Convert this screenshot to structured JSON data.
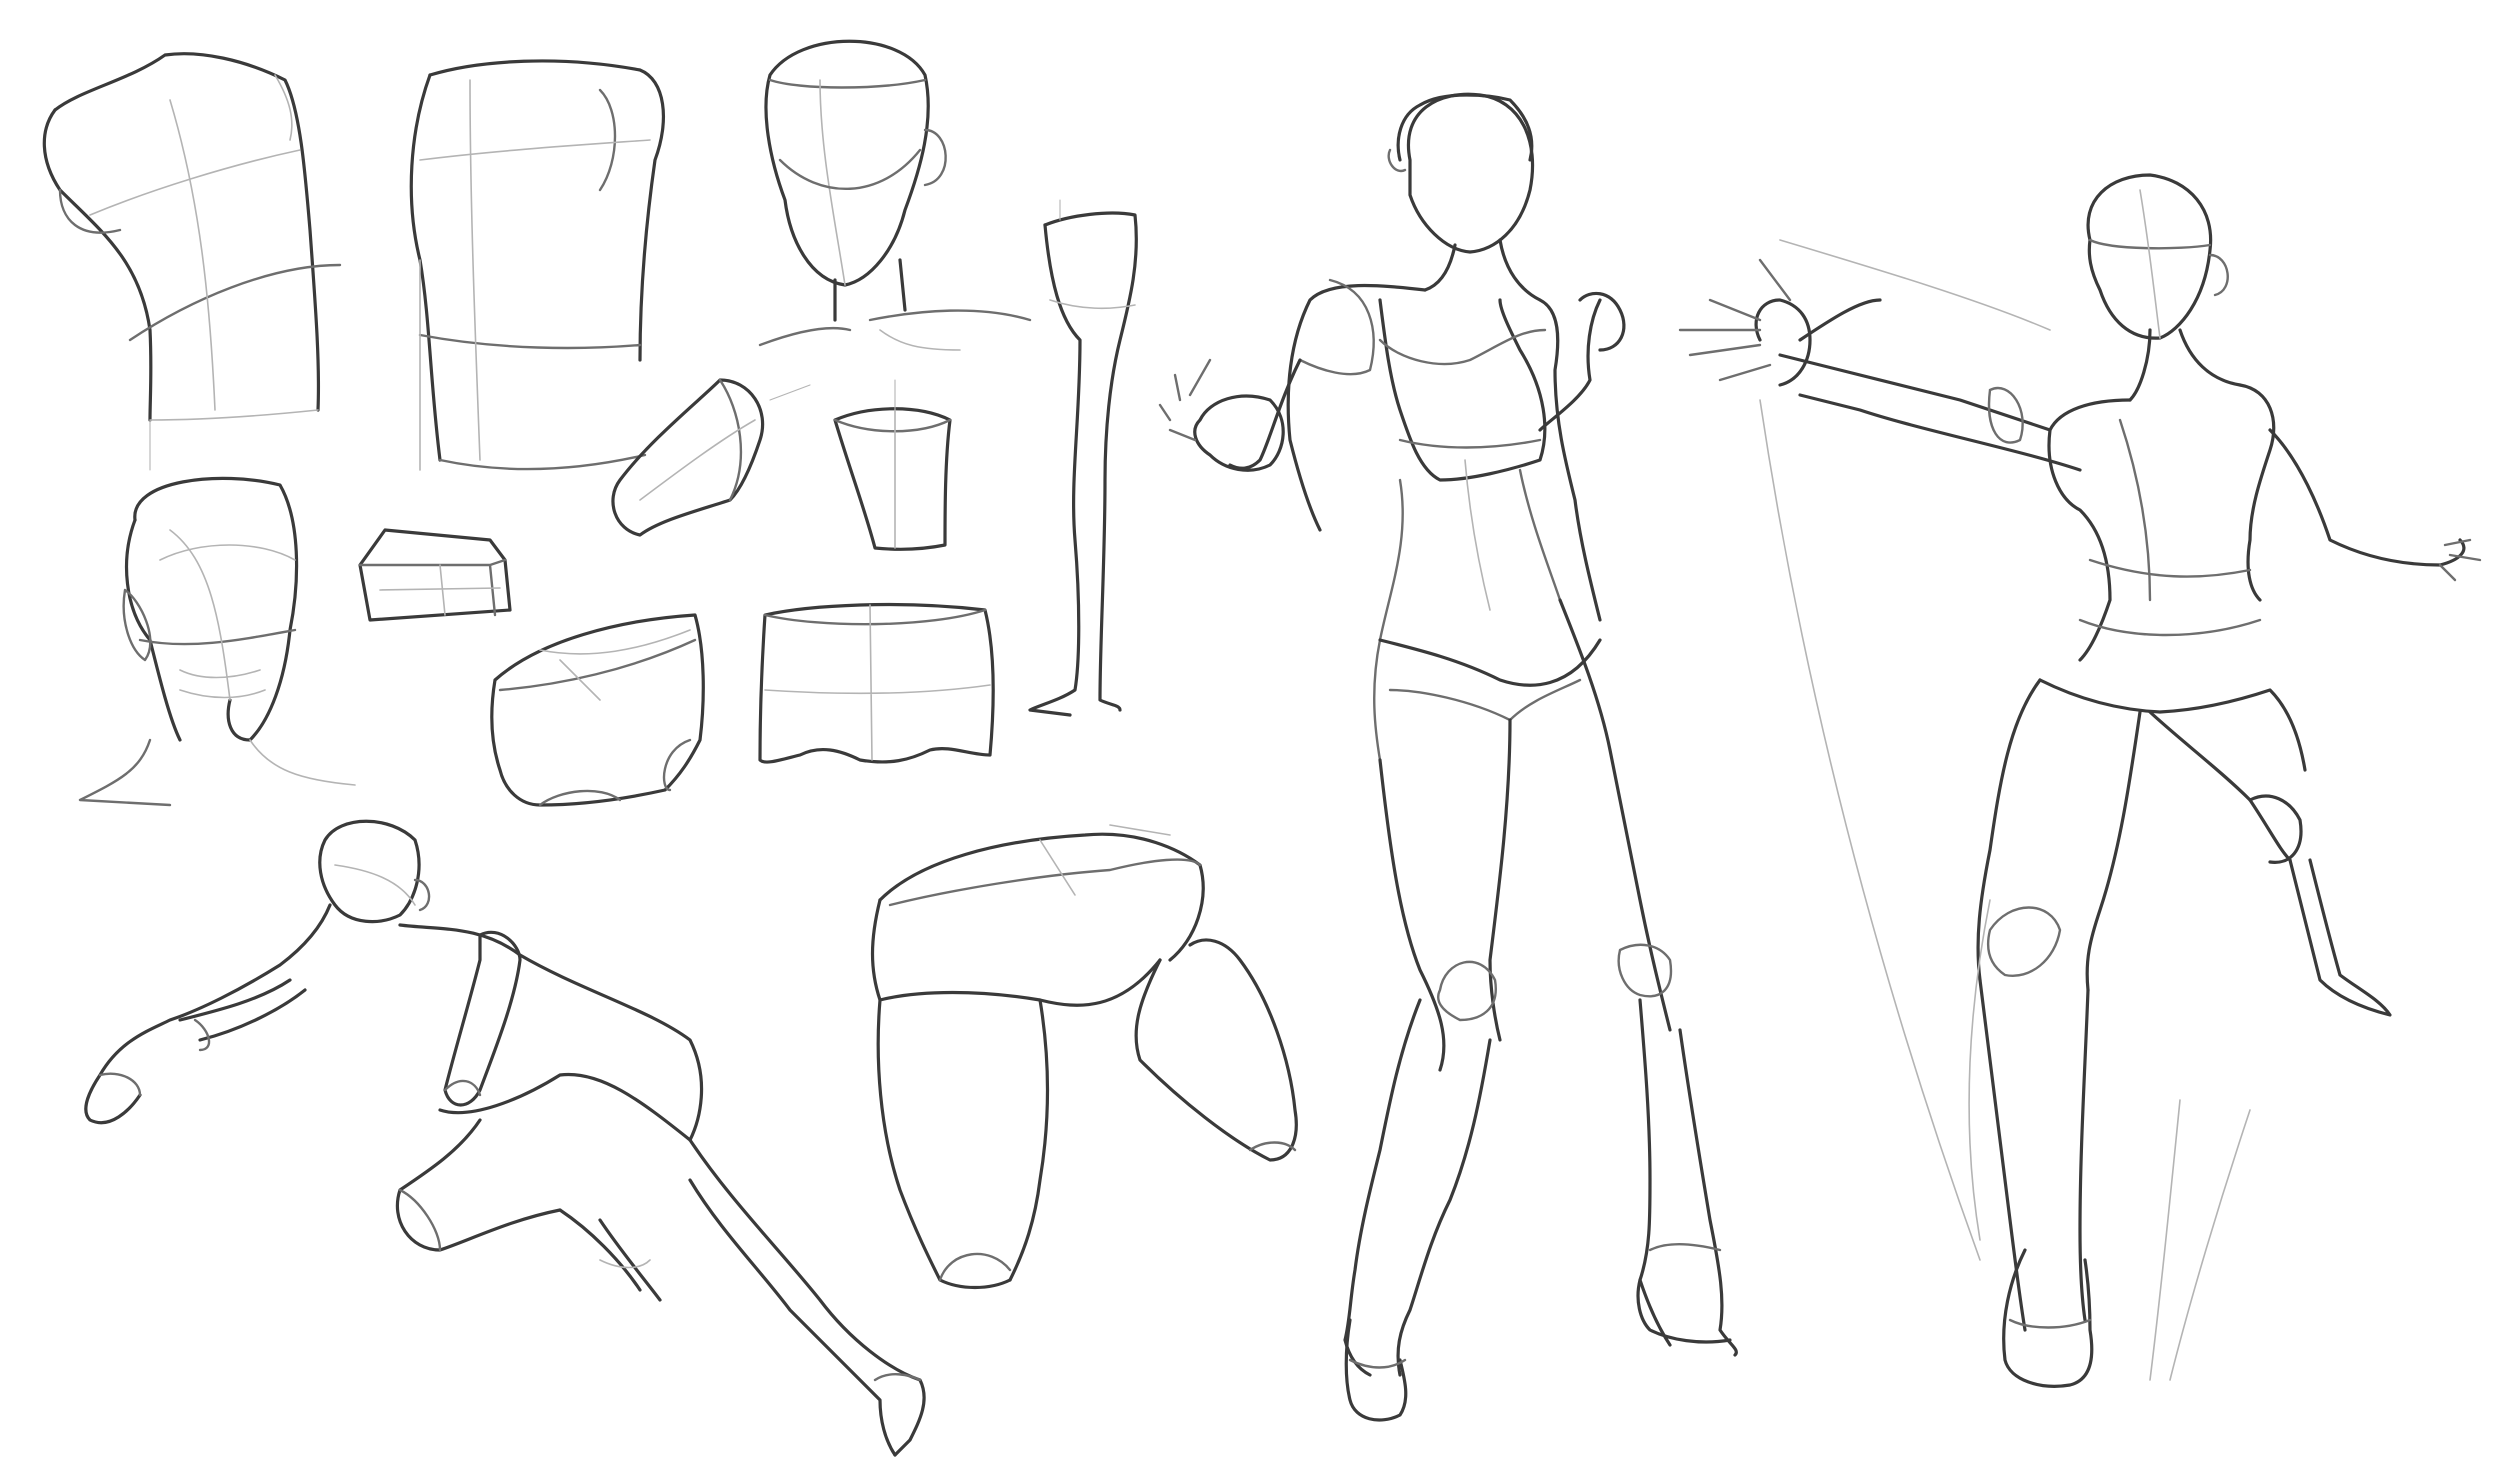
{
  "canvas": {
    "background": "#ffffff",
    "ink_dark": "#3a3a3a",
    "ink_mid": "#6e6e6e",
    "ink_light": "#b4b4b4"
  },
  "sketches": [
    "torso-front-sketch",
    "torso-back-sketch",
    "head-neck-front-sketch",
    "arm-leg-sketch",
    "head-three-quarter-sketch",
    "box-sketch",
    "tapered-cylinder-sketch",
    "cup-shape-sketch",
    "pelvis-box-sketch",
    "pelvis-front-sketch",
    "crouching-figure-sketch",
    "hips-thighs-sketch",
    "standing-woman-sketch",
    "reaching-figure-sketch"
  ]
}
